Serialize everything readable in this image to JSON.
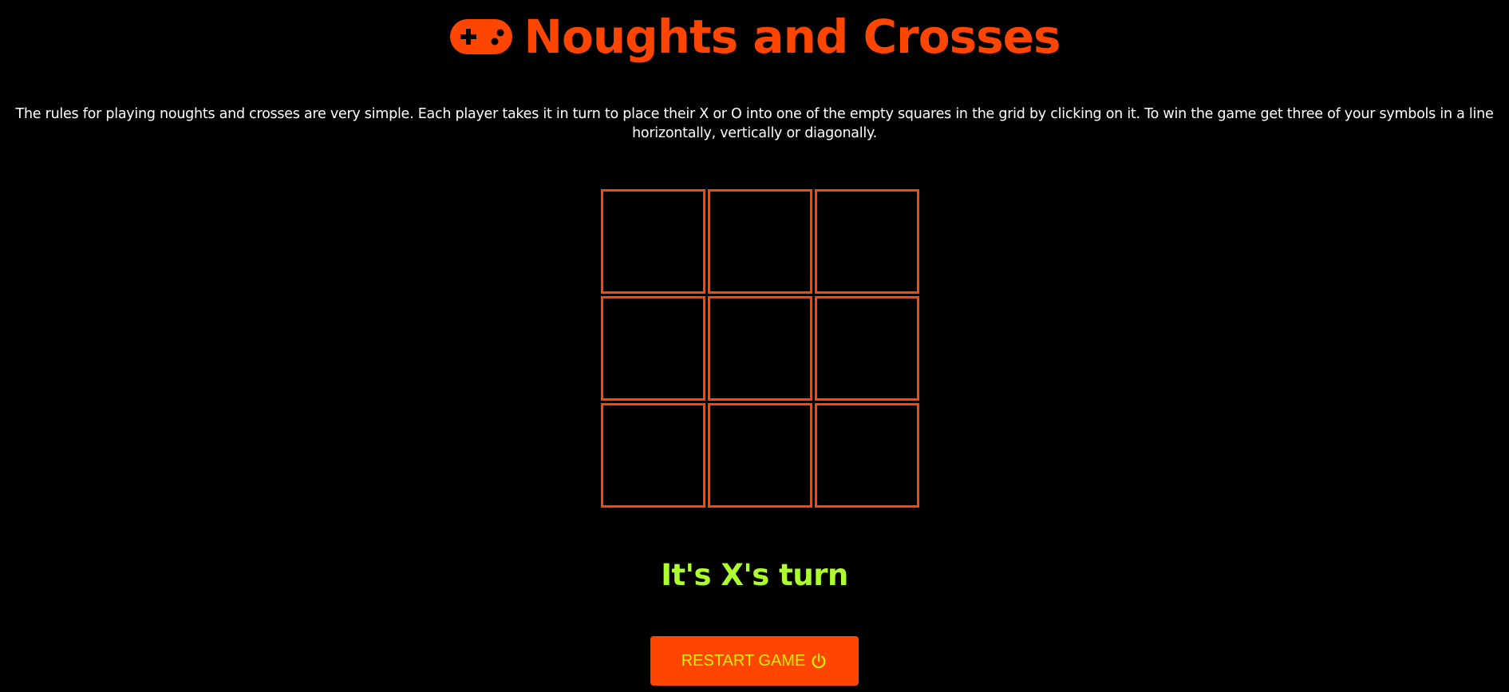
{
  "header": {
    "icon": "gamepad-icon",
    "title": "Noughts and Crosses"
  },
  "rules": {
    "text": "The rules for playing noughts and crosses are very simple. Each player takes it in turn to place their X or O into one of the empty squares in the grid by clicking on it. To win the game get three of your symbols in a line horizontally, vertically or diagonally."
  },
  "board": {
    "cells": [
      "",
      "",
      "",
      "",
      "",
      "",
      "",
      "",
      ""
    ]
  },
  "status": {
    "text": "It's X's turn"
  },
  "restart": {
    "label": "RESTART GAME",
    "icon": "power-icon"
  },
  "colors": {
    "background": "#000000",
    "accent": "#ff4500",
    "status": "#adff2f",
    "button_text": "#d4f000",
    "rules_text": "#ffffff"
  }
}
